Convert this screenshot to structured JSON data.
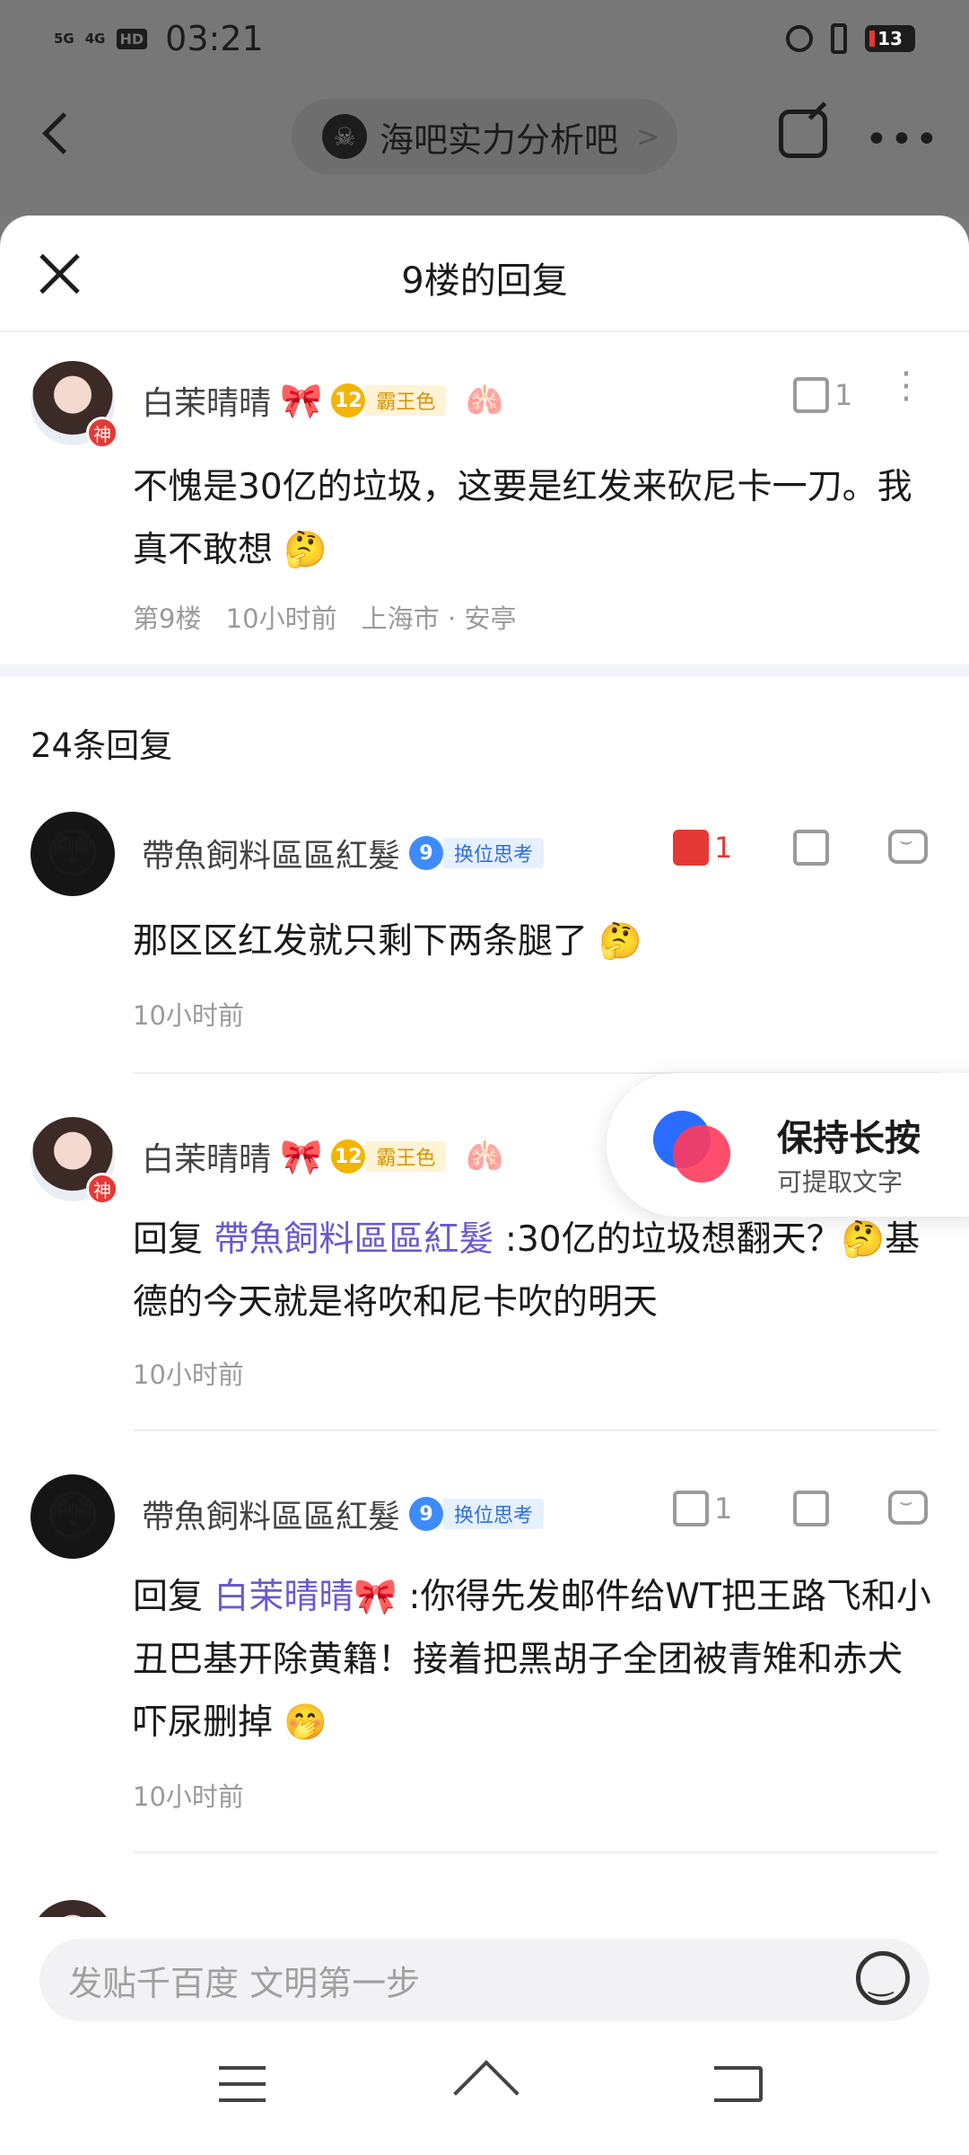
{
  "status_bar": {
    "network_1": "5G",
    "network_2": "4G",
    "hd": "HD",
    "time": "03:21",
    "battery": "13"
  },
  "topbar": {
    "forum_name": "海吧实力分析吧",
    "forum_chevron": ">"
  },
  "sheet": {
    "title": "9楼的回复"
  },
  "main_post": {
    "author": "白茉晴晴",
    "bow": "🎀",
    "level": "12",
    "level_title": "霸王色",
    "god_badge": "神",
    "likes": "1",
    "text": "不愧是30亿的垃圾，这要是红发来砍尼卡一刀。我真不敢想 🤔",
    "floor": "第9楼",
    "time": "10小时前",
    "location": "上海市 · 安亭"
  },
  "reply_count": "24条回复",
  "replies": [
    {
      "author": "帶魚飼料區區紅髮",
      "avatar_emoji": "😳",
      "level": "9",
      "level_title": "换位思考",
      "likes": "1",
      "prefix": "",
      "mention": "",
      "text": "那区区红发就只剩下两条腿了 🤔",
      "time": "10小时前"
    },
    {
      "author": "白茉晴晴",
      "bow": "🎀",
      "level": "12",
      "level_title": "霸王色",
      "prefix": "回复",
      "mention": "帶魚飼料區區紅髮",
      "text": ":30亿的垃圾想翻天？🤔基德的今天就是将吹和尼卡吹的明天",
      "time": "10小时前"
    },
    {
      "author": "帶魚飼料區區紅髮",
      "avatar_emoji": "😳",
      "level": "9",
      "level_title": "换位思考",
      "likes": "1",
      "prefix": "回复",
      "mention": "白茉晴晴🎀",
      "text": ":你得先发邮件给WT把王路飞和小丑巴基开除黄籍！接着把黑胡子全团被青雉和赤犬吓尿删掉 🤭",
      "time": "10小时前"
    }
  ],
  "tip": {
    "title": "保持长按",
    "subtitle": "可提取文字"
  },
  "input": {
    "placeholder": "发贴千百度 文明第一步"
  },
  "colors": {
    "accent_red": "#e53935",
    "mention": "#6a5acd",
    "gold_badge": "#f4b400",
    "blue_badge": "#3d8bfd"
  }
}
